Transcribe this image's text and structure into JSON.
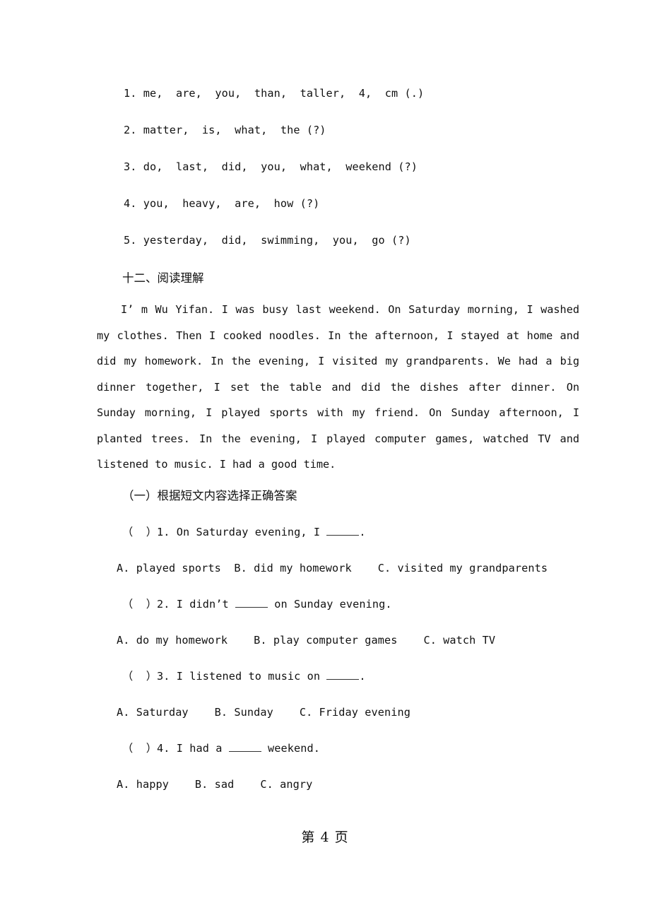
{
  "document": {
    "page_footer": "第 4 页"
  },
  "reorder_section": {
    "items": [
      "1. me,  are,  you,  than,  taller,  4,  cm (.)",
      "2. matter,  is,  what,  the (?)",
      "3. do,  last,  did,  you,  what,  weekend (?)",
      "4. you,  heavy,  are,  how (?)",
      "5. yesterday,  did,  swimming,  you,  go (?)"
    ]
  },
  "reading_section": {
    "heading": "十二、阅读理解",
    "passage_indent": "",
    "passage": "I’ m Wu Yifan. I was busy last weekend. On Saturday morning, I washed my clothes. Then I cooked noodles. In the afternoon, I stayed at home and did my homework. In the evening, I visited my grandparents. We had a big dinner together, I set the table and did the dishes after dinner. On Sunday morning, I played sports with my friend. On Sunday afternoon, I planted trees. In the evening, I played computer games, watched TV and listened to music. I had a good time.",
    "subsection_heading": "（一）根据短文内容选择正确答案",
    "questions": [
      {
        "prefix": "（  ）1. On Saturday evening, I ",
        "suffix": ".",
        "options": "A. played sports  B. did my homework    C. visited my grandparents"
      },
      {
        "prefix": "（  ）2. I didn’t ",
        "suffix": " on Sunday evening.",
        "options": "A. do my homework    B. play computer games    C. watch TV"
      },
      {
        "prefix": "（  ）3. I listened to music on ",
        "suffix": ".",
        "options": "A. Saturday    B. Sunday    C. Friday evening"
      },
      {
        "prefix": "（  ）4. I had a ",
        "suffix": " weekend.",
        "options": "A. happy    B. sad    C. angry"
      }
    ]
  }
}
